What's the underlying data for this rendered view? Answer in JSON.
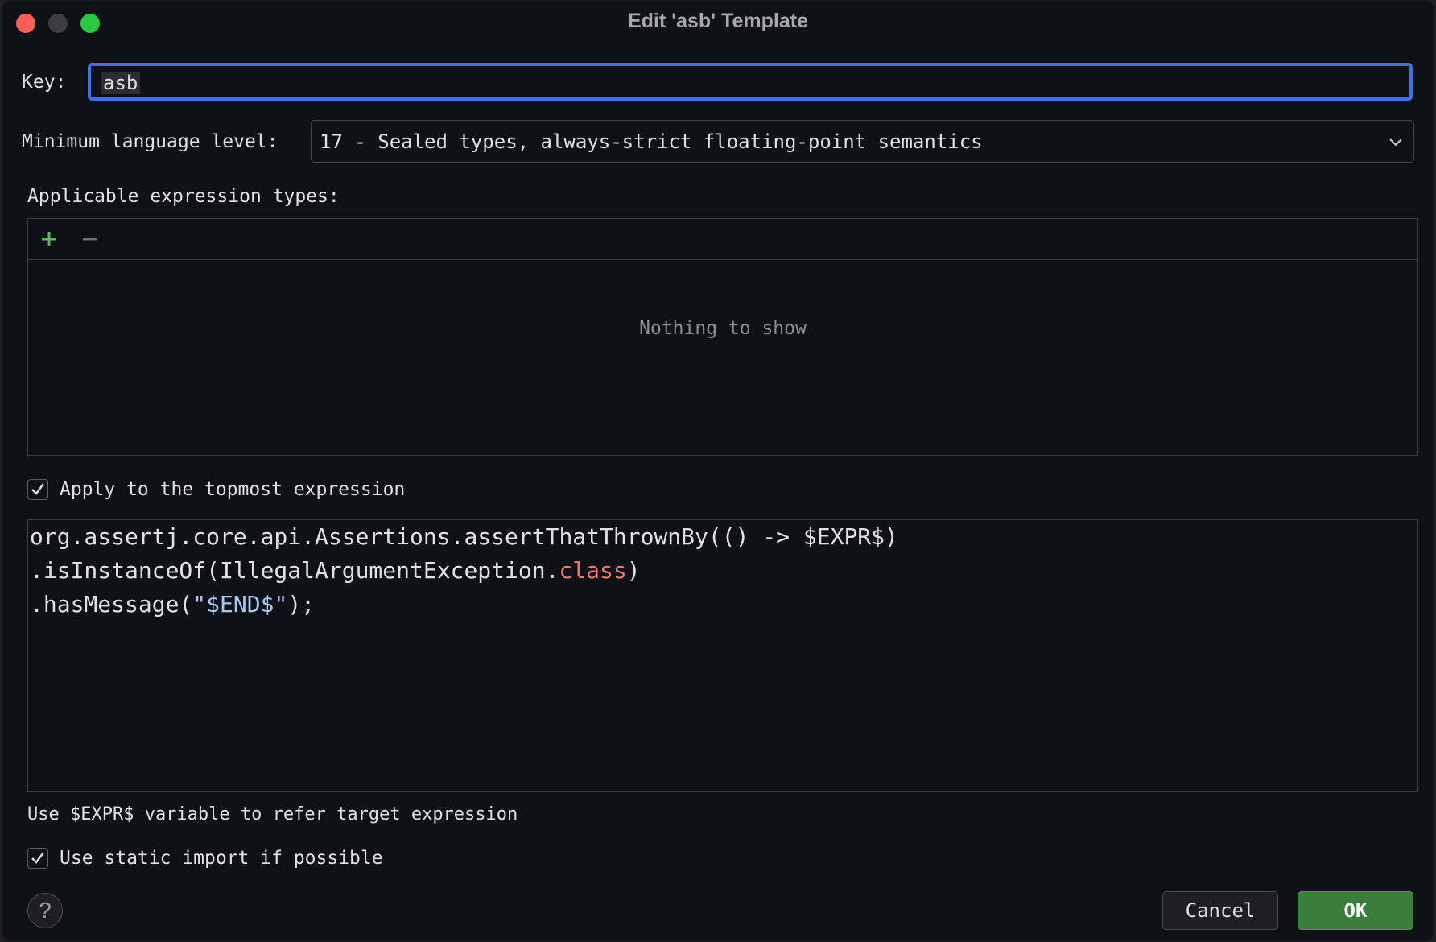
{
  "window": {
    "title": "Edit 'asb' Template"
  },
  "key": {
    "label": "Key:",
    "value": "asb"
  },
  "language_level": {
    "label": "Minimum language level:",
    "selected": "17 - Sealed types, always-strict floating-point semantics"
  },
  "expression_types": {
    "label": "Applicable expression types:",
    "add_icon": "plus-icon",
    "remove_icon": "minus-icon",
    "empty_text": "Nothing to show"
  },
  "apply_topmost": {
    "label": "Apply to the topmost expression",
    "checked": true
  },
  "template_code": {
    "line1": "org.assertj.core.api.Assertions.assertThatThrownBy(() -> $EXPR$)",
    "line2_prefix": ".isInstanceOf(IllegalArgumentException.",
    "line2_keyword": "class",
    "line2_suffix": ")",
    "line3_prefix": ".hasMessage(",
    "line3_string": "\"$END$\"",
    "line3_suffix": ");"
  },
  "hint_text": "Use $EXPR$ variable to refer target expression",
  "static_import": {
    "label": "Use static import if possible",
    "checked": true
  },
  "buttons": {
    "help": "?",
    "cancel": "Cancel",
    "ok": "OK"
  },
  "colors": {
    "accent": "#3574f0",
    "ok_button": "#3b7d3b",
    "keyword": "#f2756d",
    "string": "#a9c7f5"
  }
}
